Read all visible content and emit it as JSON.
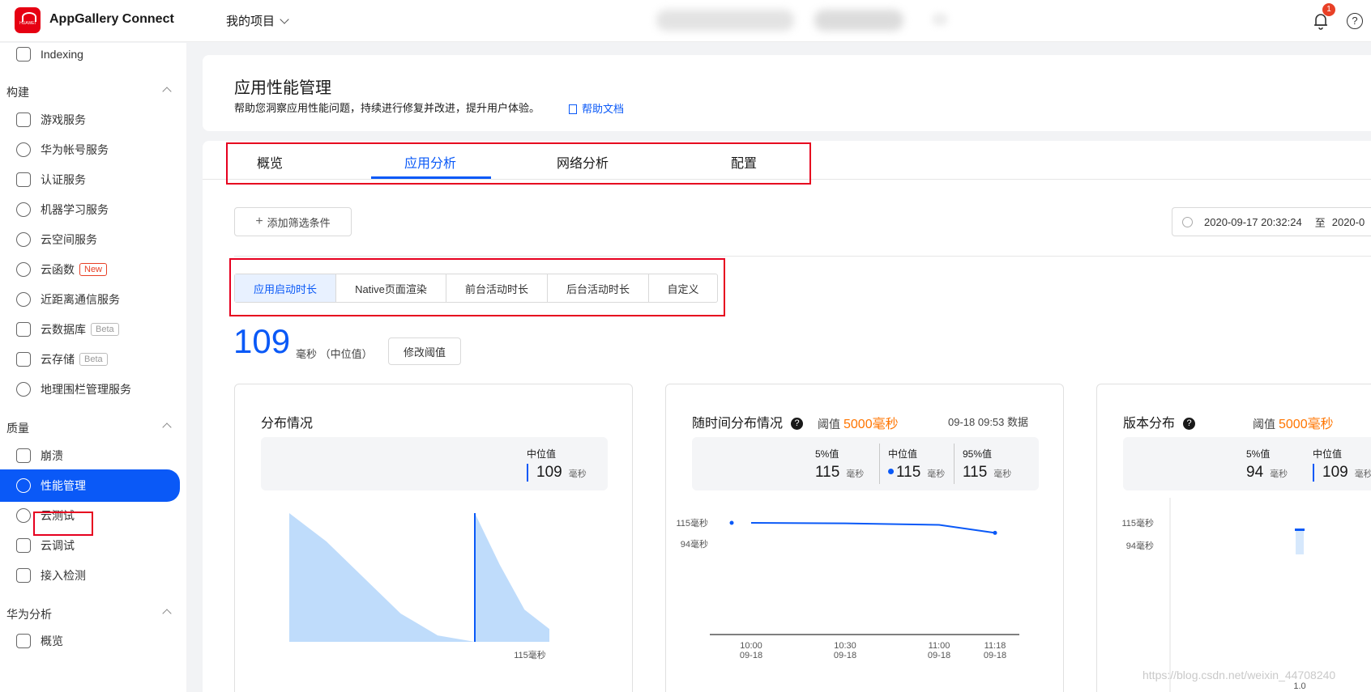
{
  "topbar": {
    "logo_text": "HUAWEI",
    "brand": "AppGallery Connect",
    "project": "我的项目",
    "notification_count": "1",
    "help_label": "?"
  },
  "sidebar": {
    "top_item": "Indexing",
    "sections": [
      {
        "label": "构建",
        "items": [
          "游戏服务",
          "华为帐号服务",
          "认证服务",
          "机器学习服务",
          "云空间服务",
          "云函数",
          "近距离通信服务",
          "云数据库",
          "云存储",
          "地理围栏管理服务"
        ]
      },
      {
        "label": "质量",
        "items": [
          "崩溃",
          "性能管理",
          "云测试",
          "云调试",
          "接入检测"
        ]
      },
      {
        "label": "华为分析",
        "items": [
          "概览"
        ]
      }
    ],
    "tags": {
      "new": "New",
      "beta": "Beta"
    },
    "active_item": "性能管理"
  },
  "header": {
    "title": "应用性能管理",
    "subtitle": "帮助您洞察应用性能问题，持续进行修复并改进，提升用户体验。",
    "help_doc": "帮助文档"
  },
  "tabs": [
    "概览",
    "应用分析",
    "网络分析",
    "配置"
  ],
  "active_tab": "应用分析",
  "filter": {
    "add_label": "添加筛选条件",
    "date_from": "2020-09-17 20:32:24",
    "date_sep": "至",
    "date_to": "2020-0"
  },
  "metric_tabs": [
    "应用启动时长",
    "Native页面渲染",
    "前台活动时长",
    "后台活动时长",
    "自定义"
  ],
  "active_metric": "应用启动时长",
  "summary": {
    "value": "109",
    "unit": "毫秒",
    "note": "（中位值）",
    "edit_threshold": "修改阈值"
  },
  "cards": {
    "distribution": {
      "title": "分布情况",
      "median_label": "中位值",
      "median_value": "109",
      "unit": "毫秒",
      "x_label": "115毫秒"
    },
    "over_time": {
      "title": "随时间分布情况",
      "help": "?",
      "threshold_label": "阈值",
      "threshold_value": "5000毫秒",
      "data_time": "09-18 09:53 数据",
      "stats": [
        {
          "label": "5%值",
          "value": "115"
        },
        {
          "label": "中位值",
          "value": "115"
        },
        {
          "label": "95%值",
          "value": "115"
        }
      ],
      "unit": "毫秒"
    },
    "version": {
      "title": "版本分布",
      "help": "?",
      "threshold_label": "阈值",
      "threshold_value": "5000毫秒",
      "stats": [
        {
          "label": "5%值",
          "value": "94"
        },
        {
          "label": "中位值",
          "value": "109"
        }
      ],
      "unit": "毫秒"
    }
  },
  "chart_data": [
    {
      "type": "area",
      "title": "分布情况",
      "x_tick_labels": [
        "115毫秒"
      ],
      "series": [
        {
          "values": [
            1.0,
            0.78,
            0.5,
            0.22,
            0.05,
            0.0
          ]
        },
        {
          "values": [
            1.0,
            0.6,
            0.25,
            0.1
          ]
        }
      ],
      "marker_label": "中位值",
      "grid": false
    },
    {
      "type": "line",
      "title": "随时间分布情况",
      "y_tick_labels": [
        "115毫秒",
        "94毫秒"
      ],
      "x": [
        "10:00",
        "10:30",
        "11:00",
        "11:18"
      ],
      "x_dates": [
        "09-18",
        "09-18",
        "09-18",
        "09-18"
      ],
      "series": [
        {
          "values": [
            115,
            114.5,
            113,
            105
          ]
        }
      ],
      "ylim": [
        94,
        115
      ],
      "grid": false
    },
    {
      "type": "bar",
      "title": "版本分布",
      "y_tick_labels": [
        "115毫秒",
        "94毫秒"
      ],
      "categories": [
        "1.0"
      ],
      "range": [
        94,
        115
      ],
      "median": 109,
      "ylim": [
        94,
        115
      ]
    }
  ],
  "watermark": "https://blog.csdn.net/weixin_44708240",
  "colors": {
    "accent": "#0a59f7",
    "threshold": "#ff7500",
    "highlight_box": "#e6001f",
    "area_fill": "#bfdcfb"
  }
}
